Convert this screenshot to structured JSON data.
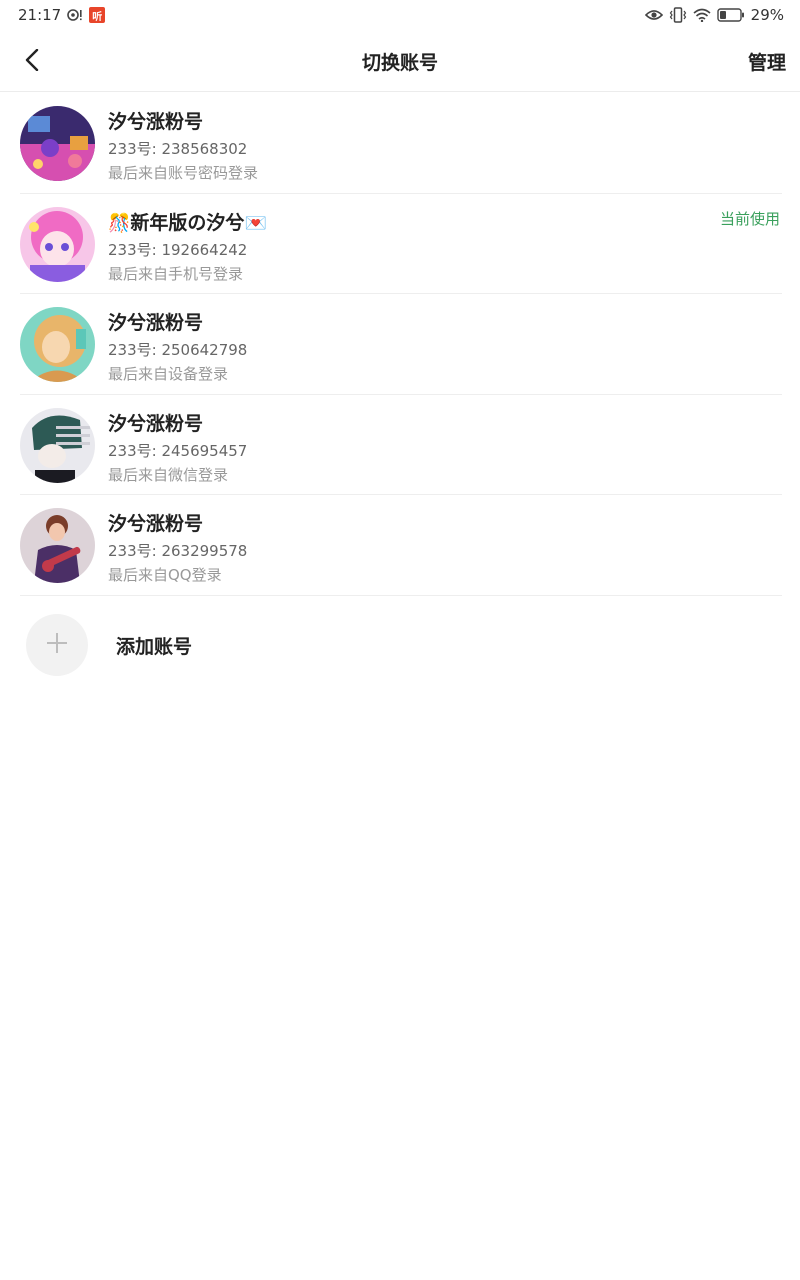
{
  "status_bar": {
    "time": "21:17",
    "app_badge": "听",
    "battery": "29%"
  },
  "header": {
    "title": "切换账号",
    "manage_label": "管理"
  },
  "accounts": [
    {
      "name": "汐兮涨粉号",
      "id_text": "233号: 238568302",
      "login_text": "最后来自账号密码登录",
      "current": false,
      "avatar_colors": [
        "#6b3fa8",
        "#e24fa0"
      ]
    },
    {
      "name_prefix_emoji": "🎊",
      "name": "新年版の汐兮",
      "name_suffix_emoji": "💌",
      "id_text": "233号: 192664242",
      "login_text": "最后来自手机号登录",
      "current": true,
      "current_label": "当前使用",
      "avatar_colors": [
        "#f06bc4",
        "#7b5de0"
      ]
    },
    {
      "name": "汐兮涨粉号",
      "id_text": "233号: 250642798",
      "login_text": "最后来自设备登录",
      "current": false,
      "avatar_colors": [
        "#e8b56a",
        "#7fd6c4"
      ]
    },
    {
      "name": "汐兮涨粉号",
      "id_text": "233号: 245695457",
      "login_text": "最后来自微信登录",
      "current": false,
      "avatar_colors": [
        "#e6e6ea",
        "#2d5a55"
      ]
    },
    {
      "name": "汐兮涨粉号",
      "id_text": "233号: 263299578",
      "login_text": "最后来自QQ登录",
      "current": false,
      "avatar_colors": [
        "#c9b8c0",
        "#5a3b6e"
      ]
    }
  ],
  "add_account": {
    "label": "添加账号"
  },
  "colors": {
    "accent_green": "#3aa05c",
    "divider": "#eeeeee"
  }
}
